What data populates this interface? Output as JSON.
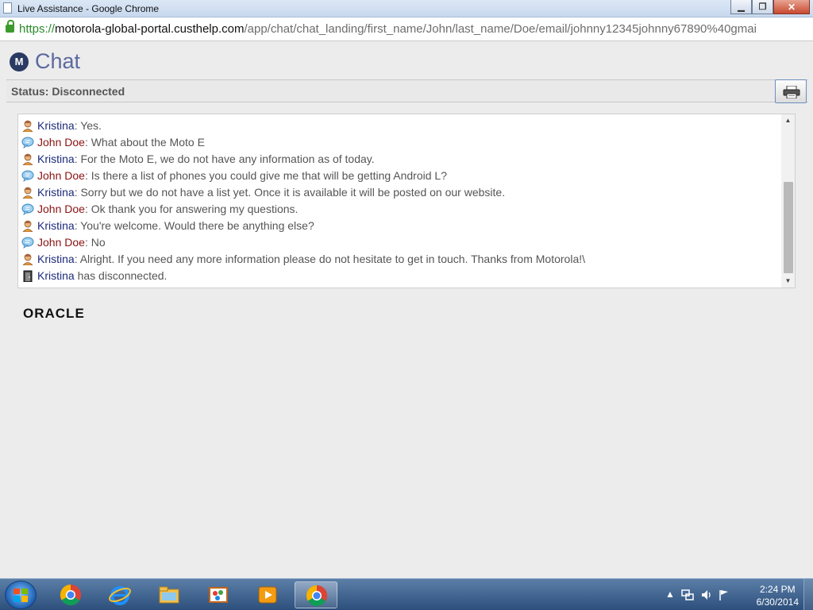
{
  "window": {
    "title": "Live Assistance - Google Chrome",
    "minimize_glyph": "▁",
    "restore_glyph": "❐",
    "close_glyph": "✕"
  },
  "address": {
    "scheme": "https://",
    "host": "motorola-global-portal.custhelp.com",
    "path": "/app/chat/chat_landing/first_name/John/last_name/Doe/email/johnny12345johnny67890%40gmai"
  },
  "chat": {
    "logo_letter": "M",
    "title": "Chat",
    "status": "Status: Disconnected"
  },
  "colors": {
    "agent_name": "#1d2a7a",
    "user_name": "#8b1212",
    "accent": "#5b6a9e"
  },
  "transcript": {
    "messages": [
      {
        "who": "agent",
        "icon": "agent-avatar-icon",
        "name": "Kristina",
        "sep": ":",
        "text": " Yes."
      },
      {
        "who": "user",
        "icon": "chat-bubble-icon",
        "name": "John Doe",
        "sep": ":",
        "text": " What about the Moto E"
      },
      {
        "who": "agent",
        "icon": "agent-avatar-icon",
        "name": "Kristina",
        "sep": ":",
        "text": " For the Moto E, we do not have any information as of today."
      },
      {
        "who": "user",
        "icon": "chat-bubble-icon",
        "name": "John Doe",
        "sep": ":",
        "text": " Is there a list of phones you could give me that will be getting Android L?"
      },
      {
        "who": "agent",
        "icon": "agent-avatar-icon",
        "name": "Kristina",
        "sep": ":",
        "text": " Sorry but we do not have a list yet. Once it is available it will be posted on our website."
      },
      {
        "who": "user",
        "icon": "chat-bubble-icon",
        "name": "John Doe",
        "sep": ":",
        "text": " Ok thank you for answering my questions."
      },
      {
        "who": "agent",
        "icon": "agent-avatar-icon",
        "name": "Kristina",
        "sep": ":",
        "text": " You're welcome. Would there be anything else?"
      },
      {
        "who": "user",
        "icon": "chat-bubble-icon",
        "name": "John Doe",
        "sep": ":",
        "text": " No"
      },
      {
        "who": "agent",
        "icon": "agent-avatar-icon",
        "name": "Kristina",
        "sep": ":",
        "text": " Alright. If you need any more information please do not hesitate to get in touch. Thanks from Motorola!\\"
      },
      {
        "who": "agent",
        "icon": "door-exit-icon",
        "name": "Kristina",
        "sep": "",
        "text": " has disconnected."
      }
    ]
  },
  "footer": {
    "logo_text": "ORACLE"
  },
  "taskbar": {
    "apps": [
      "chrome-icon",
      "internet-explorer-icon",
      "file-explorer-icon",
      "paint-app-icon",
      "media-player-icon",
      "chrome-icon"
    ],
    "tray_arrow": "▲",
    "time": "2:24 PM",
    "date": "6/30/2014"
  }
}
